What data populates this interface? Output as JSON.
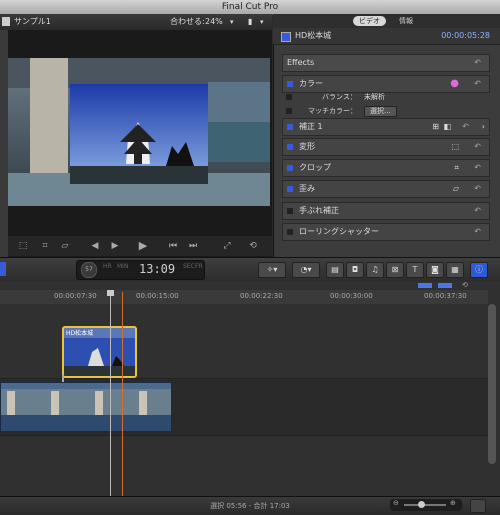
{
  "window": {
    "title": "Final Cut Pro"
  },
  "viewer": {
    "project_name": "サンプル1",
    "fit_label": "合わせる:",
    "zoom": "24%"
  },
  "inspector": {
    "tabs": [
      "ビデオ",
      "情報"
    ],
    "clip_name": "HD松本城",
    "clip_duration": "00:00:05:28",
    "effects_label": "Effects",
    "sections": {
      "color": "カラー",
      "balance_label": "バランス：",
      "balance_value": "未解析",
      "match_label": "マッチカラー：",
      "match_button": "選択...",
      "correction": "補正 1",
      "transform": "変形",
      "crop": "クロップ",
      "distort": "歪み",
      "stabilization": "手ぶれ補正",
      "rolling_shutter": "ローリングシャッター"
    }
  },
  "toolbar": {
    "timecode": "13:09",
    "tc_prefix": "57",
    "tc_labels": [
      "HR",
      "MIN",
      "SEC",
      "FR"
    ]
  },
  "timeline": {
    "ruler": [
      "00:00:07:30",
      "00:00:15:00",
      "00:00:22:30",
      "00:00:30:00",
      "00:00:37:30"
    ],
    "connected_clip_name": "HD松本城"
  },
  "status": {
    "selection": "選択 05:56 - 合計 17:03"
  },
  "colors": {
    "accent": "#3b5ad8",
    "clip_border": "#e8c436",
    "playhead": "#d07030"
  }
}
